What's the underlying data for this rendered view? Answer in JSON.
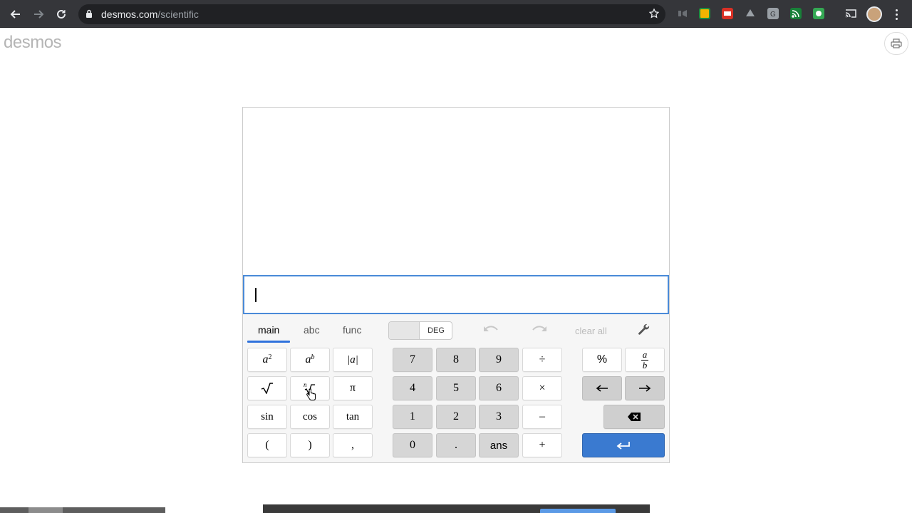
{
  "browser": {
    "url_host": "desmos.com",
    "url_path": "/scientific",
    "colors": {
      "chrome_bg": "#35363a",
      "omnibox_bg": "#202124",
      "text": "#e8eaed"
    },
    "extension_icons": [
      "cast-dim-icon",
      "google-classroom-icon",
      "pdf-extension-icon",
      "google-drive-icon",
      "grammarly-icon",
      "cast-feed-icon",
      "green-extension-icon"
    ]
  },
  "page": {
    "logo": "desmos"
  },
  "calculator": {
    "expression_value": "",
    "tabs": [
      "main",
      "abc",
      "func"
    ],
    "active_tab": "main",
    "angle_mode": "DEG",
    "clear_all_label": "clear all",
    "keys": {
      "abs": "|a|",
      "pi": "π",
      "sin": "sin",
      "cos": "cos",
      "tan": "tan",
      "lparen": "(",
      "rparen": ")",
      "comma": ",",
      "n7": "7",
      "n8": "8",
      "n9": "9",
      "n4": "4",
      "n5": "5",
      "n6": "6",
      "n1": "1",
      "n2": "2",
      "n3": "3",
      "n0": "0",
      "dot": ".",
      "ans": "ans",
      "divide": "÷",
      "times": "×",
      "minus": "–",
      "plus": "+",
      "percent": "%",
      "left": "←",
      "right": "→"
    },
    "colors": {
      "accent": "#2f72dc",
      "enter_key": "#3a7ad0",
      "numpad_key": "#d6d6d6"
    }
  }
}
